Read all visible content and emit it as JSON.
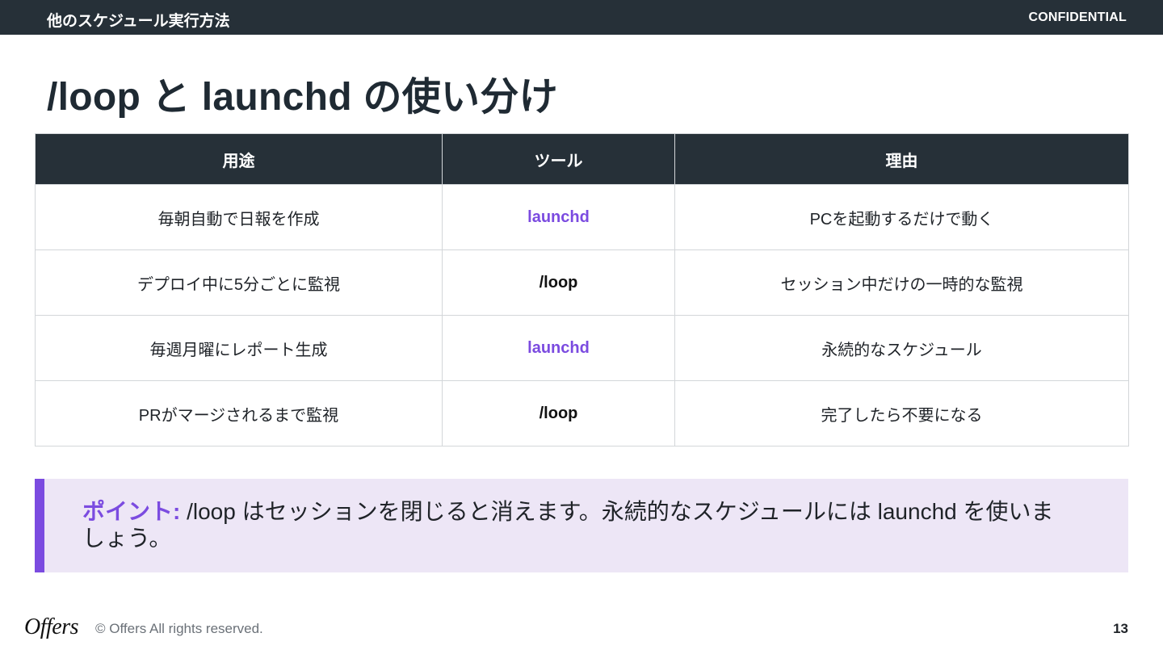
{
  "header": {
    "section_title": "他のスケジュール実行方法",
    "confidential": "CONFIDENTIAL"
  },
  "slide": {
    "title": "/loop と launchd の使い分け"
  },
  "table": {
    "headers": [
      "用途",
      "ツール",
      "理由"
    ],
    "rows": [
      {
        "use": "毎朝自動で日報を作成",
        "tool": "launchd",
        "reason": "PCを起動するだけで動く"
      },
      {
        "use": "デプロイ中に5分ごとに監視",
        "tool": "/loop",
        "reason": "セッション中だけの一時的な監視"
      },
      {
        "use": "毎週月曜にレポート生成",
        "tool": "launchd",
        "reason": "永続的なスケジュール"
      },
      {
        "use": "PRがマージされるまで監視",
        "tool": "/loop",
        "reason": "完了したら不要になる"
      }
    ]
  },
  "note": {
    "label": "ポイント:",
    "text": " /loop はセッションを閉じると消えます。永続的なスケジュールには launchd を使いましょう。"
  },
  "footer": {
    "logo": "Offers",
    "copyright": "© Offers All rights reserved.",
    "page_number": "13"
  },
  "colors": {
    "header_bg": "#263038",
    "accent_purple": "#7b4be0",
    "note_bg": "#ede6f6"
  }
}
